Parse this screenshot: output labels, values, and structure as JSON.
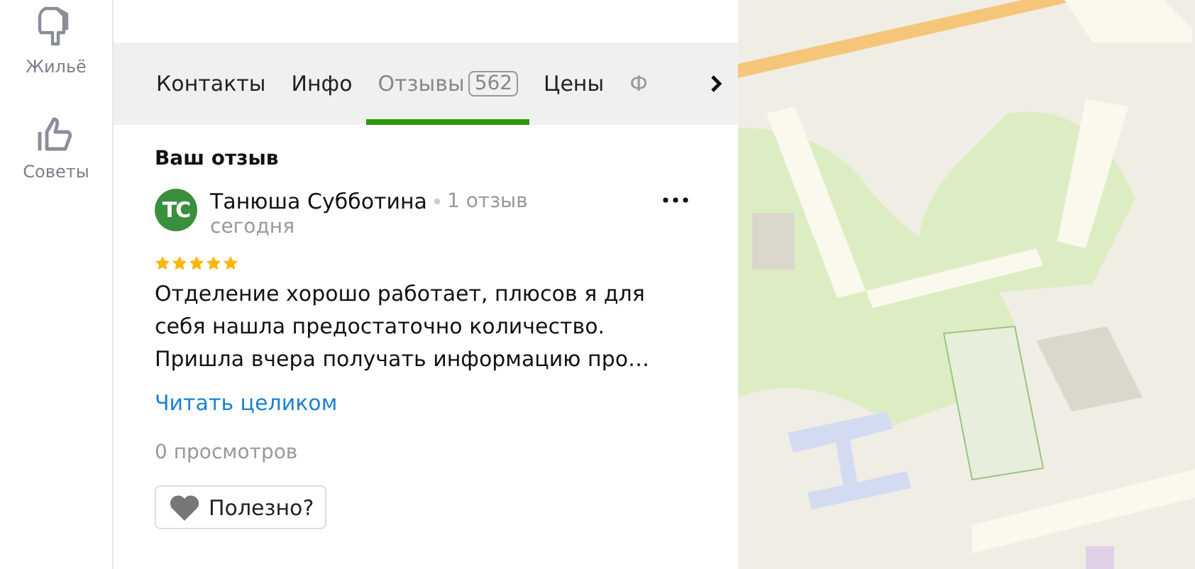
{
  "sidebar": {
    "items": [
      {
        "label": "Жильё",
        "kind": "housing"
      },
      {
        "label": "Советы",
        "kind": "tips"
      }
    ]
  },
  "tabs": [
    {
      "label": "Контакты",
      "selected": false,
      "faded": false
    },
    {
      "label": "Инфо",
      "selected": false,
      "faded": false
    },
    {
      "label": "Отзывы",
      "count": "562",
      "selected": true,
      "faded": false
    },
    {
      "label": "Цены",
      "selected": false,
      "faded": false
    },
    {
      "label": "Ф",
      "selected": false,
      "faded": true
    }
  ],
  "section_title": "Ваш отзыв",
  "review": {
    "avatar": "ТС",
    "author": "Танюша Субботина",
    "author_reviews": "1 отзыв",
    "date": "сегодня",
    "stars": 5,
    "text": "Отделение хорошо работает, плюсов я для себя нашла предостаточно количество. Пришла вчера получать информацию про…",
    "read_more": "Читать целиком",
    "views": "0 просмотров",
    "helpful": "Полезно?"
  }
}
